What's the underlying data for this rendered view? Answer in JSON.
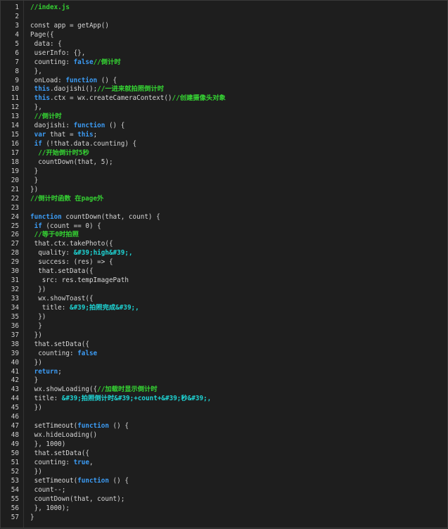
{
  "editor": {
    "lines": [
      {
        "n": "1",
        "parts": [
          {
            "t": "c",
            "v": "//index.js"
          }
        ]
      },
      {
        "n": "2",
        "parts": []
      },
      {
        "n": "3",
        "parts": [
          {
            "t": "p",
            "v": "const app = getApp()"
          }
        ]
      },
      {
        "n": "4",
        "parts": [
          {
            "t": "p",
            "v": "Page({"
          }
        ]
      },
      {
        "n": "5",
        "parts": [
          {
            "t": "p",
            "v": " data: {"
          }
        ]
      },
      {
        "n": "6",
        "parts": [
          {
            "t": "p",
            "v": " userInfo: {},"
          }
        ]
      },
      {
        "n": "7",
        "parts": [
          {
            "t": "p",
            "v": " counting: "
          },
          {
            "t": "kb",
            "v": "false"
          },
          {
            "t": "c",
            "v": "//倒计时"
          }
        ]
      },
      {
        "n": "8",
        "parts": [
          {
            "t": "p",
            "v": " },"
          }
        ]
      },
      {
        "n": "9",
        "parts": [
          {
            "t": "p",
            "v": " onLoad: "
          },
          {
            "t": "kb",
            "v": "function"
          },
          {
            "t": "p",
            "v": " () {"
          }
        ]
      },
      {
        "n": "10",
        "parts": [
          {
            "t": "kb",
            "v": " this"
          },
          {
            "t": "p",
            "v": ".daojishi();"
          },
          {
            "t": "c",
            "v": "//一进来就拍照倒计时"
          }
        ]
      },
      {
        "n": "11",
        "parts": [
          {
            "t": "kb",
            "v": " this"
          },
          {
            "t": "p",
            "v": ".ctx = wx.createCameraContext()"
          },
          {
            "t": "c",
            "v": "//创建摄像头对象"
          }
        ]
      },
      {
        "n": "12",
        "parts": [
          {
            "t": "p",
            "v": " },"
          }
        ]
      },
      {
        "n": "13",
        "parts": [
          {
            "t": "c",
            "v": " //倒计时"
          }
        ]
      },
      {
        "n": "14",
        "parts": [
          {
            "t": "p",
            "v": " daojishi: "
          },
          {
            "t": "kb",
            "v": "function"
          },
          {
            "t": "p",
            "v": " () {"
          }
        ]
      },
      {
        "n": "15",
        "parts": [
          {
            "t": "kb",
            "v": " var"
          },
          {
            "t": "p",
            "v": " that = "
          },
          {
            "t": "kb",
            "v": "this"
          },
          {
            "t": "p",
            "v": ";"
          }
        ]
      },
      {
        "n": "16",
        "parts": [
          {
            "t": "kb",
            "v": " if"
          },
          {
            "t": "p",
            "v": " (!that.data.counting) {"
          }
        ]
      },
      {
        "n": "17",
        "parts": [
          {
            "t": "c",
            "v": "  //开始倒计时5秒"
          }
        ]
      },
      {
        "n": "18",
        "parts": [
          {
            "t": "p",
            "v": "  countDown(that, 5);"
          }
        ]
      },
      {
        "n": "19",
        "parts": [
          {
            "t": "p",
            "v": " }"
          }
        ]
      },
      {
        "n": "20",
        "parts": [
          {
            "t": "p",
            "v": " }"
          }
        ]
      },
      {
        "n": "21",
        "parts": [
          {
            "t": "p",
            "v": "})"
          }
        ]
      },
      {
        "n": "22",
        "parts": [
          {
            "t": "c",
            "v": "//倒计时函数 在page外"
          }
        ]
      },
      {
        "n": "23",
        "parts": []
      },
      {
        "n": "24",
        "parts": [
          {
            "t": "kb",
            "v": "function"
          },
          {
            "t": "p",
            "v": " countDown(that, count) {"
          }
        ]
      },
      {
        "n": "25",
        "parts": [
          {
            "t": "kb",
            "v": " if"
          },
          {
            "t": "p",
            "v": " (count == 0) {"
          }
        ]
      },
      {
        "n": "26",
        "parts": [
          {
            "t": "c",
            "v": " //等于0时拍照"
          }
        ]
      },
      {
        "n": "27",
        "parts": [
          {
            "t": "p",
            "v": " that.ctx.takePhoto({"
          }
        ]
      },
      {
        "n": "28",
        "parts": [
          {
            "t": "p",
            "v": "  quality: "
          },
          {
            "t": "s",
            "v": "&#39;high&#39;,"
          }
        ]
      },
      {
        "n": "29",
        "parts": [
          {
            "t": "p",
            "v": "  success: (res) => {"
          }
        ]
      },
      {
        "n": "30",
        "parts": [
          {
            "t": "p",
            "v": "  that.setData({"
          }
        ]
      },
      {
        "n": "31",
        "parts": [
          {
            "t": "p",
            "v": "   src: res.tempImagePath"
          }
        ]
      },
      {
        "n": "32",
        "parts": [
          {
            "t": "p",
            "v": "  })"
          }
        ]
      },
      {
        "n": "33",
        "parts": [
          {
            "t": "p",
            "v": "  wx.showToast({"
          }
        ]
      },
      {
        "n": "34",
        "parts": [
          {
            "t": "p",
            "v": "   title: "
          },
          {
            "t": "s",
            "v": "&#39;拍照完成&#39;,"
          }
        ]
      },
      {
        "n": "35",
        "parts": [
          {
            "t": "p",
            "v": "  })"
          }
        ]
      },
      {
        "n": "36",
        "parts": [
          {
            "t": "p",
            "v": "  }"
          }
        ]
      },
      {
        "n": "37",
        "parts": [
          {
            "t": "p",
            "v": " })"
          }
        ]
      },
      {
        "n": "38",
        "parts": [
          {
            "t": "p",
            "v": " that.setData({"
          }
        ]
      },
      {
        "n": "39",
        "parts": [
          {
            "t": "p",
            "v": "  counting: "
          },
          {
            "t": "kb",
            "v": "false"
          }
        ]
      },
      {
        "n": "40",
        "parts": [
          {
            "t": "p",
            "v": " })"
          }
        ]
      },
      {
        "n": "41",
        "parts": [
          {
            "t": "kb",
            "v": " return"
          },
          {
            "t": "p",
            "v": ";"
          }
        ]
      },
      {
        "n": "42",
        "parts": [
          {
            "t": "p",
            "v": " }"
          }
        ]
      },
      {
        "n": "43",
        "parts": [
          {
            "t": "p",
            "v": " wx.showLoading({"
          },
          {
            "t": "c",
            "v": "//加载时显示倒计时"
          }
        ]
      },
      {
        "n": "44",
        "parts": [
          {
            "t": "p",
            "v": " title: "
          },
          {
            "t": "s",
            "v": "&#39;拍照倒计时&#39;+count+&#39;秒&#39;,"
          }
        ]
      },
      {
        "n": "45",
        "parts": [
          {
            "t": "p",
            "v": " })"
          }
        ]
      },
      {
        "n": "46",
        "parts": []
      },
      {
        "n": "47",
        "parts": [
          {
            "t": "p",
            "v": " setTimeout("
          },
          {
            "t": "kb",
            "v": "function"
          },
          {
            "t": "p",
            "v": " () {"
          }
        ]
      },
      {
        "n": "48",
        "parts": [
          {
            "t": "p",
            "v": " wx.hideLoading()"
          }
        ]
      },
      {
        "n": "49",
        "parts": [
          {
            "t": "p",
            "v": " }, 1000)"
          }
        ]
      },
      {
        "n": "50",
        "parts": [
          {
            "t": "p",
            "v": " that.setData({"
          }
        ]
      },
      {
        "n": "51",
        "parts": [
          {
            "t": "p",
            "v": " counting: "
          },
          {
            "t": "kb",
            "v": "true"
          },
          {
            "t": "p",
            "v": ","
          }
        ]
      },
      {
        "n": "52",
        "parts": [
          {
            "t": "p",
            "v": " })"
          }
        ]
      },
      {
        "n": "53",
        "parts": [
          {
            "t": "p",
            "v": " setTimeout("
          },
          {
            "t": "kb",
            "v": "function"
          },
          {
            "t": "p",
            "v": " () {"
          }
        ]
      },
      {
        "n": "54",
        "parts": [
          {
            "t": "p",
            "v": " count--;"
          }
        ]
      },
      {
        "n": "55",
        "parts": [
          {
            "t": "p",
            "v": " countDown(that, count);"
          }
        ]
      },
      {
        "n": "56",
        "parts": [
          {
            "t": "p",
            "v": " }, 1000);"
          }
        ]
      },
      {
        "n": "57",
        "parts": [
          {
            "t": "p",
            "v": "}"
          }
        ]
      }
    ]
  }
}
